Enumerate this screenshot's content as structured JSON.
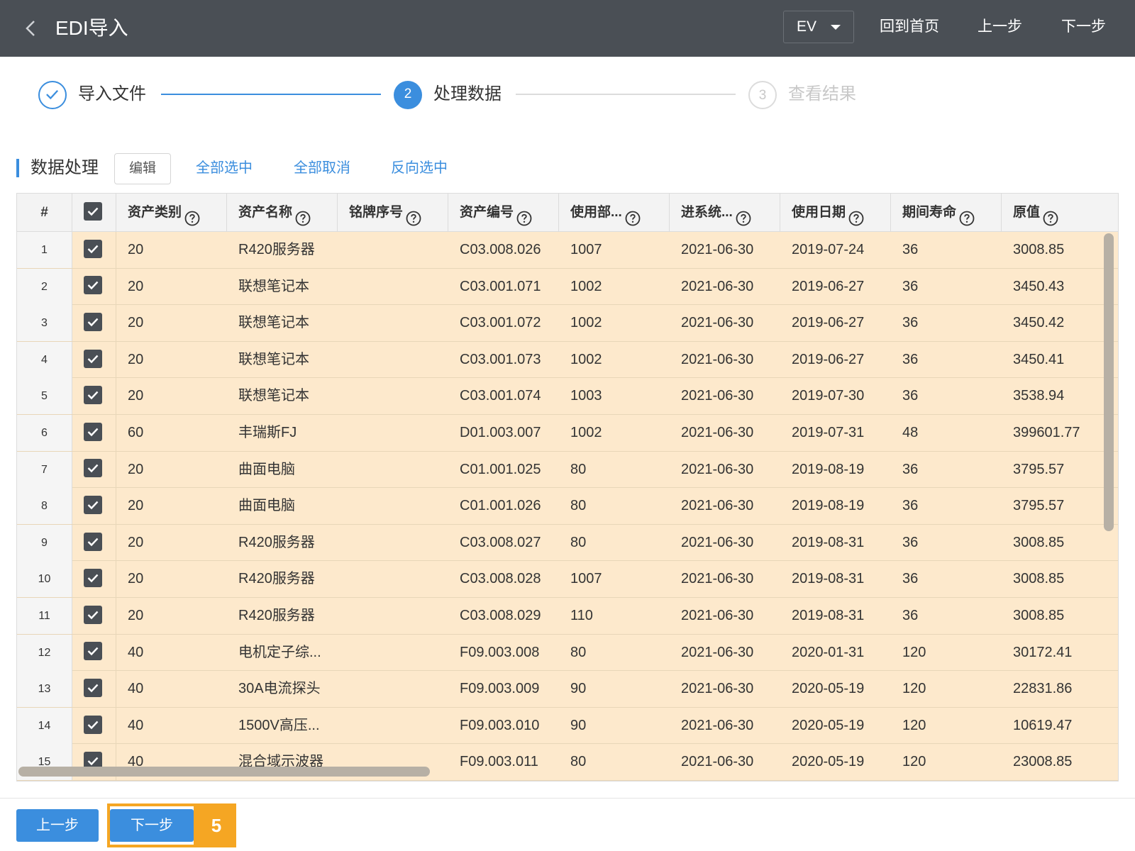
{
  "header": {
    "title": "EDI导入",
    "language": "EV",
    "home_label": "回到首页",
    "prev_label": "上一步",
    "next_label": "下一步",
    "background": "#4a4f55"
  },
  "steps": [
    {
      "label": "导入文件",
      "state": "done"
    },
    {
      "label": "处理数据",
      "number": "2",
      "state": "active"
    },
    {
      "label": "查看结果",
      "number": "3",
      "state": "pending"
    }
  ],
  "toolbar": {
    "title": "数据处理",
    "edit_label": "编辑",
    "select_all_label": "全部选中",
    "deselect_all_label": "全部取消",
    "invert_label": "反向选中"
  },
  "table": {
    "columns": [
      "#",
      "资产类别",
      "资产名称",
      "铭牌序号",
      "资产编号",
      "使用部...",
      "进系统...",
      "使用日期",
      "期间寿命",
      "原值"
    ],
    "rows": [
      {
        "n": "1",
        "cat": "20",
        "name": "R420服务器",
        "plate": "",
        "code": "C03.008.026",
        "dept": "1007",
        "entry": "2021-06-30",
        "use": "2019-07-24",
        "life": "36",
        "value": "3008.85"
      },
      {
        "n": "2",
        "cat": "20",
        "name": "联想笔记本",
        "plate": "",
        "code": "C03.001.071",
        "dept": "1002",
        "entry": "2021-06-30",
        "use": "2019-06-27",
        "life": "36",
        "value": "3450.43"
      },
      {
        "n": "3",
        "cat": "20",
        "name": "联想笔记本",
        "plate": "",
        "code": "C03.001.072",
        "dept": "1002",
        "entry": "2021-06-30",
        "use": "2019-06-27",
        "life": "36",
        "value": "3450.42"
      },
      {
        "n": "4",
        "cat": "20",
        "name": "联想笔记本",
        "plate": "",
        "code": "C03.001.073",
        "dept": "1002",
        "entry": "2021-06-30",
        "use": "2019-06-27",
        "life": "36",
        "value": "3450.41"
      },
      {
        "n": "5",
        "cat": "20",
        "name": "联想笔记本",
        "plate": "",
        "code": "C03.001.074",
        "dept": "1003",
        "entry": "2021-06-30",
        "use": "2019-07-30",
        "life": "36",
        "value": "3538.94"
      },
      {
        "n": "6",
        "cat": "60",
        "name": "丰瑞斯FJ",
        "plate": "",
        "code": "D01.003.007",
        "dept": "1002",
        "entry": "2021-06-30",
        "use": "2019-07-31",
        "life": "48",
        "value": "399601.77"
      },
      {
        "n": "7",
        "cat": "20",
        "name": "曲面电脑",
        "plate": "",
        "code": "C01.001.025",
        "dept": "80",
        "entry": "2021-06-30",
        "use": "2019-08-19",
        "life": "36",
        "value": "3795.57"
      },
      {
        "n": "8",
        "cat": "20",
        "name": "曲面电脑",
        "plate": "",
        "code": "C01.001.026",
        "dept": "80",
        "entry": "2021-06-30",
        "use": "2019-08-19",
        "life": "36",
        "value": "3795.57"
      },
      {
        "n": "9",
        "cat": "20",
        "name": "R420服务器",
        "plate": "",
        "code": "C03.008.027",
        "dept": "80",
        "entry": "2021-06-30",
        "use": "2019-08-31",
        "life": "36",
        "value": "3008.85"
      },
      {
        "n": "10",
        "cat": "20",
        "name": "R420服务器",
        "plate": "",
        "code": "C03.008.028",
        "dept": "1007",
        "entry": "2021-06-30",
        "use": "2019-08-31",
        "life": "36",
        "value": "3008.85"
      },
      {
        "n": "11",
        "cat": "20",
        "name": "R420服务器",
        "plate": "",
        "code": "C03.008.029",
        "dept": "110",
        "entry": "2021-06-30",
        "use": "2019-08-31",
        "life": "36",
        "value": "3008.85"
      },
      {
        "n": "12",
        "cat": "40",
        "name": "电机定子综...",
        "plate": "",
        "code": "F09.003.008",
        "dept": "80",
        "entry": "2021-06-30",
        "use": "2020-01-31",
        "life": "120",
        "value": "30172.41"
      },
      {
        "n": "13",
        "cat": "40",
        "name": "30A电流探头",
        "plate": "",
        "code": "F09.003.009",
        "dept": "90",
        "entry": "2021-06-30",
        "use": "2020-05-19",
        "life": "120",
        "value": "22831.86"
      },
      {
        "n": "14",
        "cat": "40",
        "name": "1500V高压...",
        "plate": "",
        "code": "F09.003.010",
        "dept": "90",
        "entry": "2021-06-30",
        "use": "2020-05-19",
        "life": "120",
        "value": "10619.47"
      },
      {
        "n": "15",
        "cat": "40",
        "name": "混合域示波器",
        "plate": "",
        "code": "F09.003.011",
        "dept": "80",
        "entry": "2021-06-30",
        "use": "2020-05-19",
        "life": "120",
        "value": "23008.85"
      }
    ],
    "row_color": "#fde9cc"
  },
  "footer": {
    "prev_label": "上一步",
    "next_label": "下一步",
    "badge": "5",
    "accent": "#3b8ede",
    "highlight": "#f5a623"
  }
}
